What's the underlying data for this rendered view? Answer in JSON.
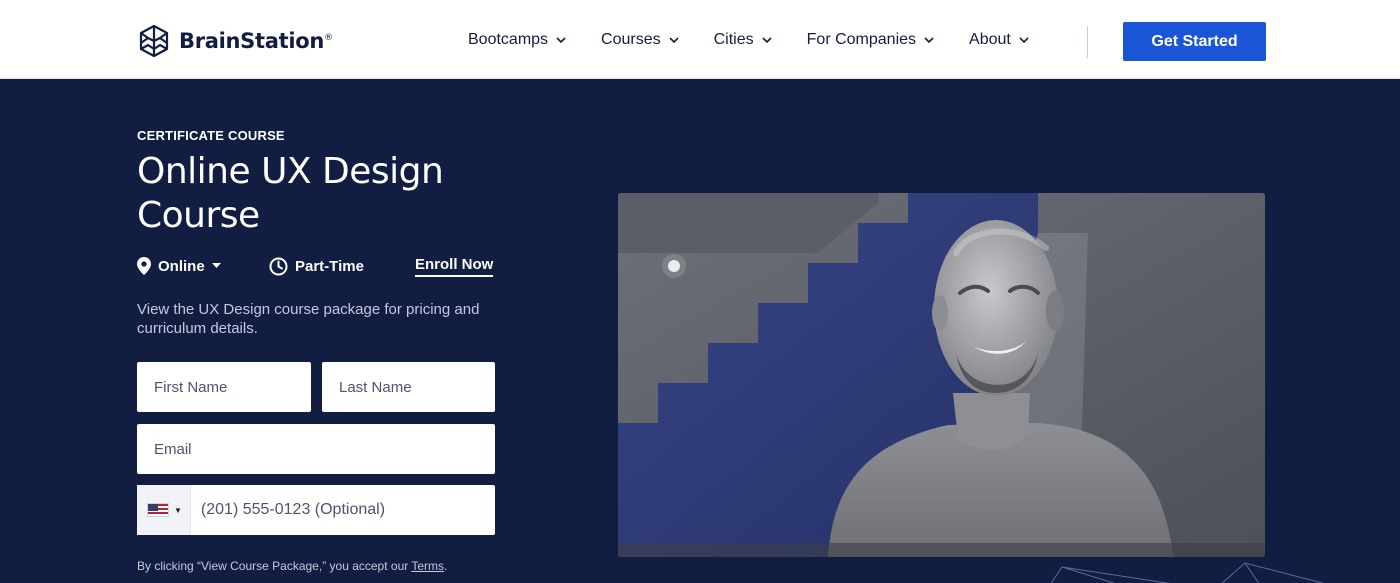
{
  "header": {
    "brand": "BrainStation",
    "brand_mark": "®",
    "nav": [
      {
        "label": "Bootcamps"
      },
      {
        "label": "Courses"
      },
      {
        "label": "Cities"
      },
      {
        "label": "For Companies"
      },
      {
        "label": "About"
      }
    ],
    "cta_label": "Get Started"
  },
  "hero": {
    "eyebrow": "CERTIFICATE COURSE",
    "title": "Online UX Design Course",
    "location": "Online",
    "schedule": "Part-Time",
    "enroll_label": "Enroll Now",
    "description": "View the UX Design course package for pricing and curriculum details."
  },
  "form": {
    "first_name_placeholder": "First Name",
    "last_name_placeholder": "Last Name",
    "email_placeholder": "Email",
    "phone_placeholder": "(201) 555-0123 (Optional)",
    "disclaimer_prefix": "By clicking “View Course Package,” you accept our ",
    "terms_label": "Terms",
    "disclaimer_suffix": "."
  },
  "colors": {
    "navy": "#121d42",
    "accent_blue": "#1a55d6",
    "white": "#ffffff"
  },
  "icons": {
    "logo": "brainstation-logo-icon",
    "nav_dropdown": "chevron-down-icon",
    "location": "location-pin-icon",
    "schedule": "clock-icon",
    "flag": "us-flag-icon"
  }
}
